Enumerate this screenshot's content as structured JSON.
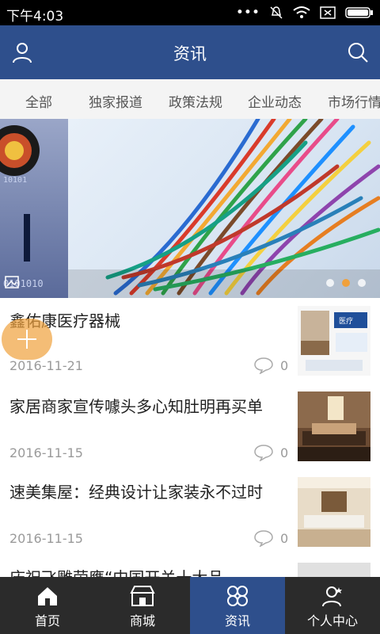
{
  "status": {
    "time": "下午4:03"
  },
  "header": {
    "title": "资讯"
  },
  "tabs": [
    "全部",
    "独家报道",
    "政策法规",
    "企业动态",
    "市场行情"
  ],
  "banner": {
    "active_dot": 2,
    "dot_count": 3
  },
  "news": [
    {
      "title": "鑫佑康医疗器械",
      "date": "2016-11-21",
      "comments": "0"
    },
    {
      "title": "家居商家宣传噱头多心知肚明再买单",
      "date": "2016-11-15",
      "comments": "0"
    },
    {
      "title": "速美集屋：经典设计让家装永不过时",
      "date": "2016-11-15",
      "comments": "0"
    },
    {
      "title": "庆祝飞雕荣膺“中国开关十大品",
      "date": "",
      "comments": ""
    }
  ],
  "bottom_nav": [
    {
      "label": "首页",
      "icon": "home-icon"
    },
    {
      "label": "商城",
      "icon": "store-icon"
    },
    {
      "label": "资讯",
      "icon": "news-icon",
      "active": true
    },
    {
      "label": "个人中心",
      "icon": "profile-icon"
    }
  ],
  "colors": {
    "primary": "#2e4f8c",
    "accent": "#f0a13c",
    "nav_bg": "#2b2b2b"
  }
}
